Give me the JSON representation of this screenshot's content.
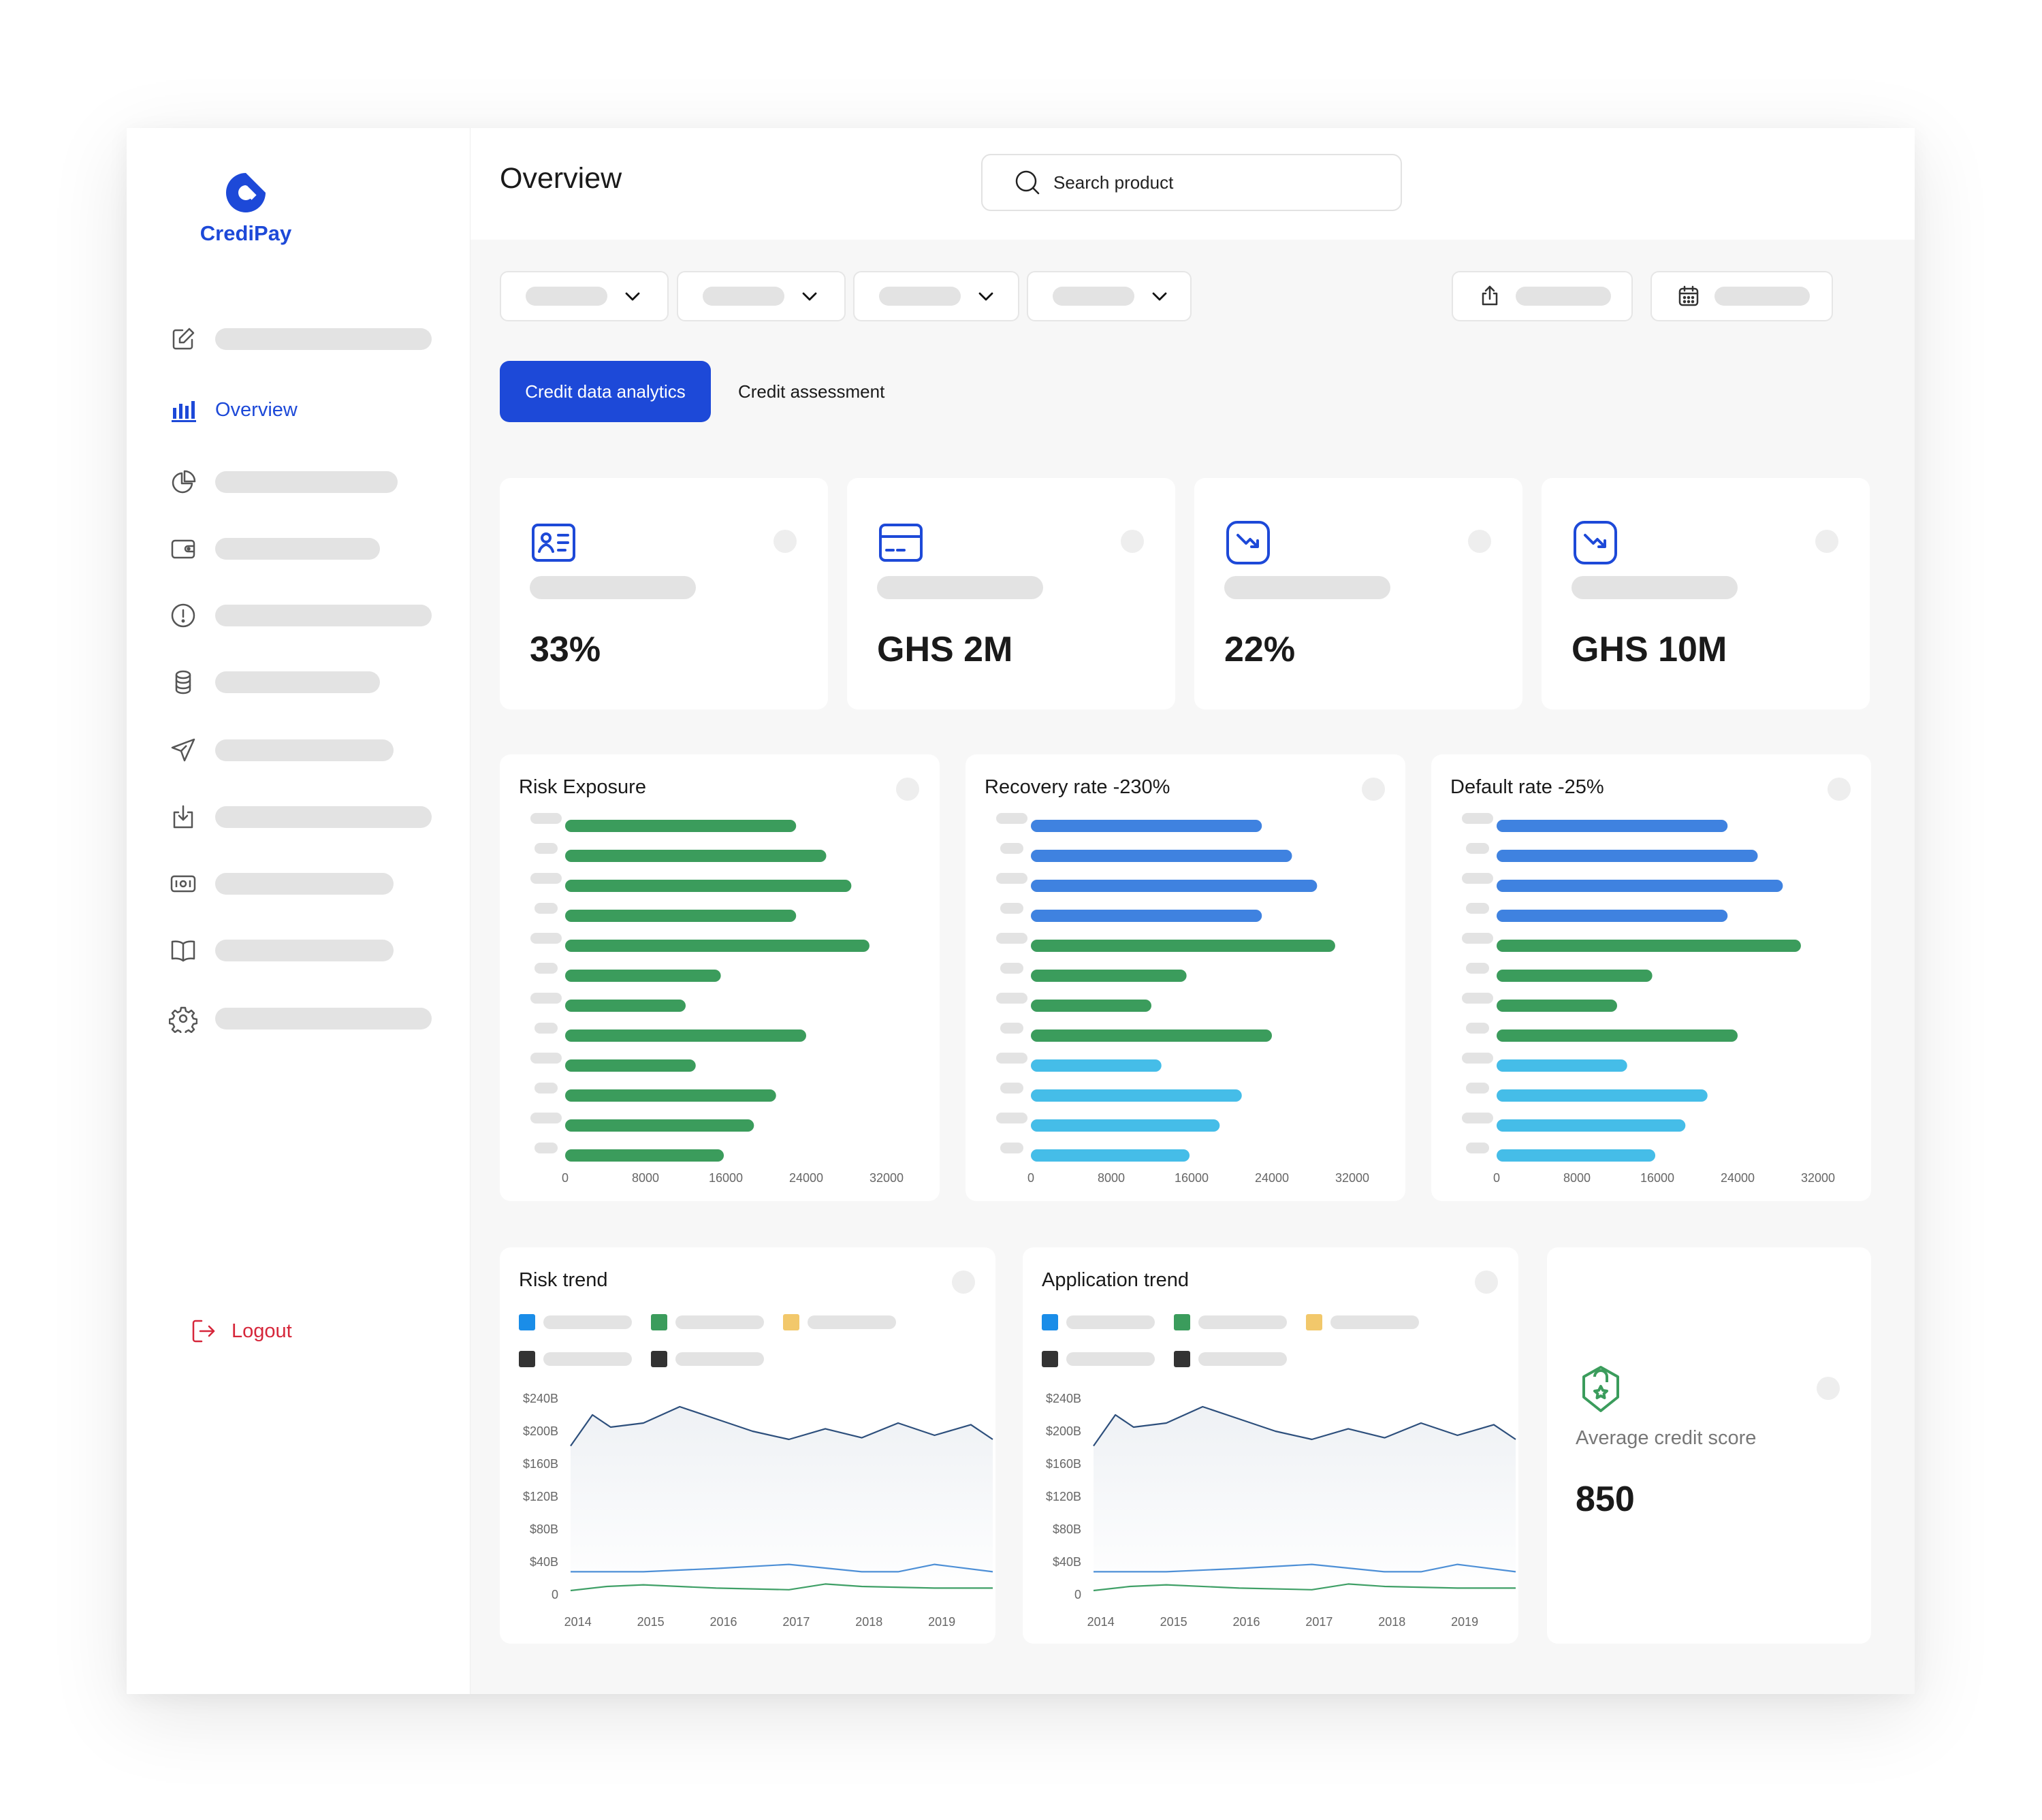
{
  "brand": {
    "name": "CrediPay",
    "color": "#1d49d8"
  },
  "header": {
    "title": "Overview",
    "search_placeholder": "Search product"
  },
  "sidebar": {
    "active_label": "Overview",
    "items": [
      {
        "icon": "edit-icon"
      },
      {
        "icon": "bar-chart-icon",
        "label": "Overview",
        "active": true
      },
      {
        "icon": "pie-chart-icon"
      },
      {
        "icon": "wallet-icon"
      },
      {
        "icon": "alert-circle-icon"
      },
      {
        "icon": "database-icon"
      },
      {
        "icon": "send-icon"
      },
      {
        "icon": "download-icon"
      },
      {
        "icon": "cash-icon"
      },
      {
        "icon": "book-icon"
      },
      {
        "icon": "settings-icon"
      }
    ],
    "logout_label": "Logout"
  },
  "tabs": {
    "active": "Credit data analytics",
    "other": "Credit assessment"
  },
  "kpis": [
    {
      "icon": "id-card-icon",
      "value": "33%"
    },
    {
      "icon": "credit-card-icon",
      "value": "GHS 2M"
    },
    {
      "icon": "trend-down-icon",
      "value": "22%"
    },
    {
      "icon": "trend-down-icon",
      "value": "GHS 10M"
    }
  ],
  "colors": {
    "green": "#3b9c5c",
    "blue": "#3f82e0",
    "cyan": "#45bde8",
    "line_navy": "#2d4f7c",
    "line_blue": "#4d8fd6",
    "line_green": "#3f9f66",
    "red": "#d6263a"
  },
  "chart_data": [
    {
      "type": "bar",
      "title": "Risk Exposure",
      "orientation": "horizontal",
      "xticks": [
        "0",
        "8000",
        "16000",
        "24000",
        "32000"
      ],
      "xlim": [
        0,
        32000
      ],
      "values": [
        23000,
        26000,
        28500,
        23000,
        30300,
        15500,
        12000,
        24000,
        13000,
        21000,
        18800,
        15800
      ],
      "bar_colors": [
        "green",
        "green",
        "green",
        "green",
        "green",
        "green",
        "green",
        "green",
        "green",
        "green",
        "green",
        "green"
      ]
    },
    {
      "type": "bar",
      "title": "Recovery rate -230%",
      "orientation": "horizontal",
      "xticks": [
        "0",
        "8000",
        "16000",
        "24000",
        "32000"
      ],
      "xlim": [
        0,
        32000
      ],
      "values": [
        23000,
        26000,
        28500,
        23000,
        30300,
        15500,
        12000,
        24000,
        13000,
        21000,
        18800,
        15800
      ],
      "bar_colors": [
        "blue",
        "blue",
        "blue",
        "blue",
        "green",
        "green",
        "green",
        "green",
        "cyan",
        "cyan",
        "cyan",
        "cyan"
      ]
    },
    {
      "type": "bar",
      "title": "Default rate -25%",
      "orientation": "horizontal",
      "xticks": [
        "0",
        "8000",
        "16000",
        "24000",
        "32000"
      ],
      "xlim": [
        0,
        32000
      ],
      "values": [
        23000,
        26000,
        28500,
        23000,
        30300,
        15500,
        12000,
        24000,
        13000,
        21000,
        18800,
        15800
      ],
      "bar_colors": [
        "blue",
        "blue",
        "blue",
        "blue",
        "green",
        "green",
        "green",
        "green",
        "cyan",
        "cyan",
        "cyan",
        "cyan"
      ]
    },
    {
      "type": "line",
      "title": "Risk trend",
      "x": [
        "2014",
        "2015",
        "2016",
        "2017",
        "2018",
        "2019"
      ],
      "yticks": [
        "$240B",
        "$200B",
        "$160B",
        "$120B",
        "$80B",
        "$40B",
        "0"
      ],
      "ylim": [
        0,
        240
      ],
      "legend_colors": [
        "#1a8de8",
        "#3b9c5c",
        "#f2c86b",
        "#333333",
        "#333333"
      ],
      "series": [
        {
          "color": "line_navy",
          "x": [
            0,
            0.3,
            0.55,
            1.0,
            1.5,
            2.0,
            2.5,
            3.0,
            3.5,
            4.0,
            4.5,
            5.0,
            5.5,
            5.8
          ],
          "values": [
            182,
            220,
            205,
            210,
            230,
            215,
            200,
            190,
            203,
            192,
            210,
            195,
            208,
            190
          ]
        },
        {
          "color": "line_blue",
          "x": [
            0,
            1.0,
            2.0,
            3.0,
            4.0,
            4.5,
            5.0,
            5.8
          ],
          "values": [
            28,
            28,
            32,
            37,
            28,
            28,
            37,
            28
          ]
        },
        {
          "color": "line_green",
          "x": [
            0,
            0.5,
            1.0,
            2.0,
            3.0,
            3.5,
            4.0,
            5.0,
            5.8
          ],
          "values": [
            5,
            10,
            12,
            8,
            6,
            13,
            10,
            8,
            8
          ]
        }
      ]
    },
    {
      "type": "line",
      "title": "Application trend",
      "x": [
        "2014",
        "2015",
        "2016",
        "2017",
        "2018",
        "2019"
      ],
      "yticks": [
        "$240B",
        "$200B",
        "$160B",
        "$120B",
        "$80B",
        "$40B",
        "0"
      ],
      "ylim": [
        0,
        240
      ],
      "legend_colors": [
        "#1a8de8",
        "#3b9c5c",
        "#f2c86b",
        "#333333",
        "#333333"
      ],
      "series": [
        {
          "color": "line_navy",
          "x": [
            0,
            0.3,
            0.55,
            1.0,
            1.5,
            2.0,
            2.5,
            3.0,
            3.5,
            4.0,
            4.5,
            5.0,
            5.5,
            5.8
          ],
          "values": [
            182,
            220,
            205,
            210,
            230,
            215,
            200,
            190,
            203,
            192,
            210,
            195,
            208,
            190
          ]
        },
        {
          "color": "line_blue",
          "x": [
            0,
            1.0,
            2.0,
            3.0,
            4.0,
            4.5,
            5.0,
            5.8
          ],
          "values": [
            28,
            28,
            32,
            37,
            28,
            28,
            37,
            28
          ]
        },
        {
          "color": "line_green",
          "x": [
            0,
            0.5,
            1.0,
            2.0,
            3.0,
            3.5,
            4.0,
            5.0,
            5.8
          ],
          "values": [
            5,
            10,
            12,
            8,
            6,
            13,
            10,
            8,
            8
          ]
        }
      ]
    }
  ],
  "score": {
    "label": "Average credit score",
    "value": "850",
    "icon": "shield-badge-icon"
  }
}
